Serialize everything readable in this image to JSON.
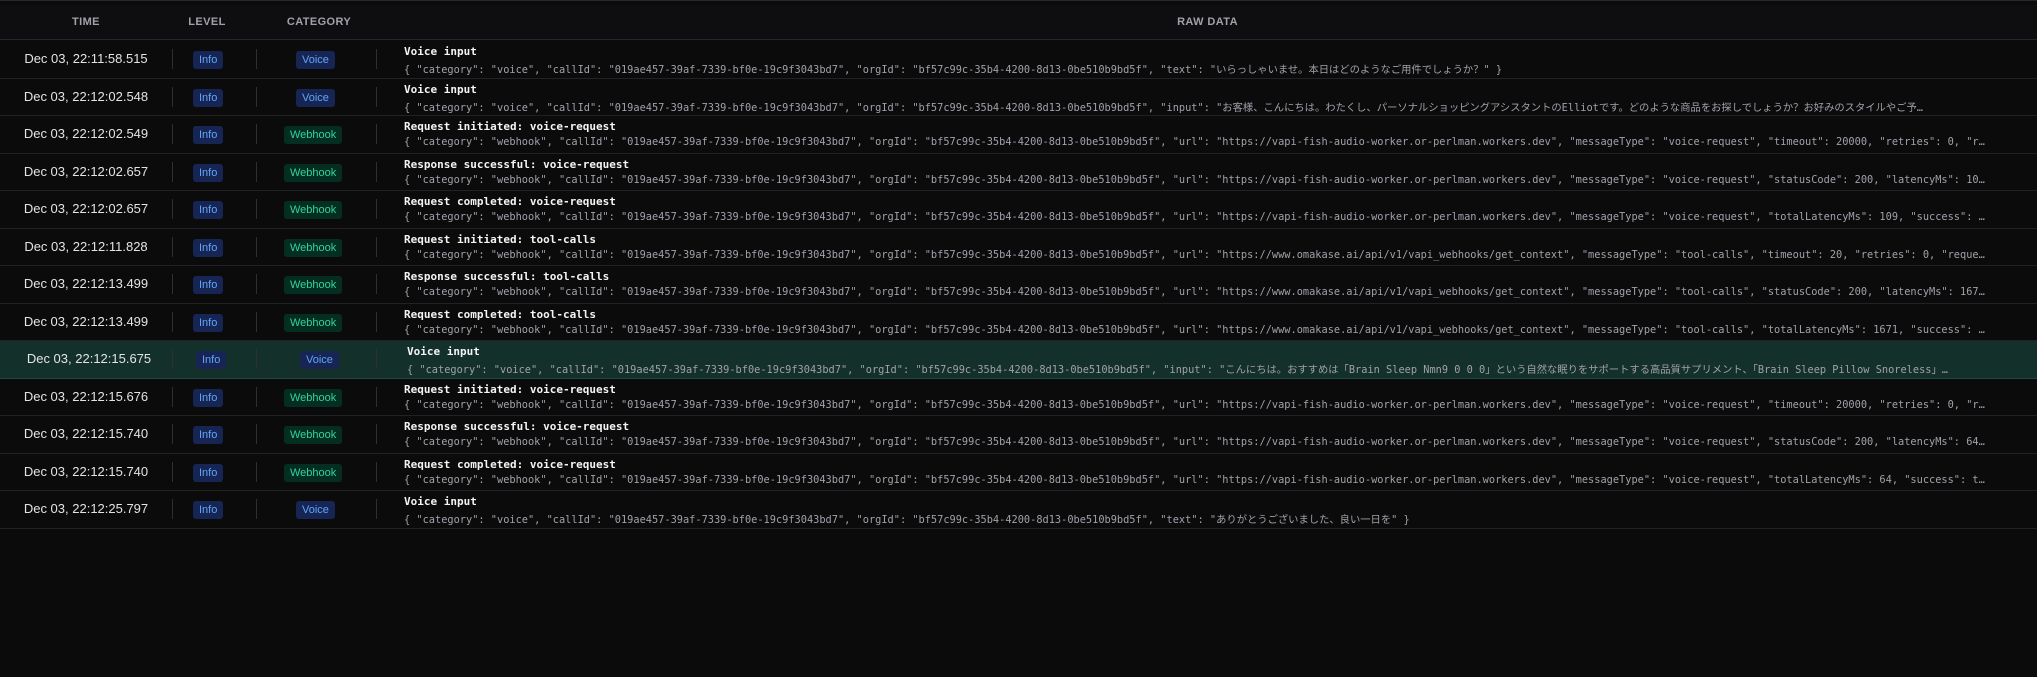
{
  "header": {
    "time": "TIME",
    "level": "LEVEL",
    "category": "CATEGORY",
    "raw": "RAW DATA"
  },
  "colors": {
    "info_badge": "#60a5fa",
    "voice_badge": "#60a5fa",
    "webhook_badge": "#34d399",
    "selected_row": "#13302b"
  },
  "rows": [
    {
      "time": "Dec 03, 22:11:58.515",
      "level": "Info",
      "category": "Voice",
      "message": "Voice input",
      "raw": "{ \"category\": \"voice\", \"callId\": \"019ae457-39af-7339-bf0e-19c9f3043bd7\", \"orgId\": \"bf57c99c-35b4-4200-8d13-0be510b9bd5f\", \"text\": \"いらっしゃいませ。本日はどのようなご用件でしょうか？\" }"
    },
    {
      "time": "Dec 03, 22:12:02.548",
      "level": "Info",
      "category": "Voice",
      "message": "Voice input",
      "raw": "{ \"category\": \"voice\", \"callId\": \"019ae457-39af-7339-bf0e-19c9f3043bd7\", \"orgId\": \"bf57c99c-35b4-4200-8d13-0be510b9bd5f\", \"input\": \"お客様、こんにちは。わたくし、パーソナルショッピングアシスタントのElliotです。どのような商品をお探しでしょうか？お好みのスタイルやご予…"
    },
    {
      "time": "Dec 03, 22:12:02.549",
      "level": "Info",
      "category": "Webhook",
      "message": "Request initiated: voice-request",
      "raw": "{ \"category\": \"webhook\", \"callId\": \"019ae457-39af-7339-bf0e-19c9f3043bd7\", \"orgId\": \"bf57c99c-35b4-4200-8d13-0be510b9bd5f\", \"url\": \"https://vapi-fish-audio-worker.or-perlman.workers.dev\", \"messageType\": \"voice-request\", \"timeout\": 20000, \"retries\": 0, \"re…"
    },
    {
      "time": "Dec 03, 22:12:02.657",
      "level": "Info",
      "category": "Webhook",
      "message": "Response successful: voice-request",
      "raw": "{ \"category\": \"webhook\", \"callId\": \"019ae457-39af-7339-bf0e-19c9f3043bd7\", \"orgId\": \"bf57c99c-35b4-4200-8d13-0be510b9bd5f\", \"url\": \"https://vapi-fish-audio-worker.or-perlman.workers.dev\", \"messageType\": \"voice-request\", \"statusCode\": 200, \"latencyMs\": 109…"
    },
    {
      "time": "Dec 03, 22:12:02.657",
      "level": "Info",
      "category": "Webhook",
      "message": "Request completed: voice-request",
      "raw": "{ \"category\": \"webhook\", \"callId\": \"019ae457-39af-7339-bf0e-19c9f3043bd7\", \"orgId\": \"bf57c99c-35b4-4200-8d13-0be510b9bd5f\", \"url\": \"https://vapi-fish-audio-worker.or-perlman.workers.dev\", \"messageType\": \"voice-request\", \"totalLatencyMs\": 109, \"success\": t…"
    },
    {
      "time": "Dec 03, 22:12:11.828",
      "level": "Info",
      "category": "Webhook",
      "message": "Request initiated: tool-calls",
      "raw": "{ \"category\": \"webhook\", \"callId\": \"019ae457-39af-7339-bf0e-19c9f3043bd7\", \"orgId\": \"bf57c99c-35b4-4200-8d13-0be510b9bd5f\", \"url\": \"https://www.omakase.ai/api/v1/vapi_webhooks/get_context\", \"messageType\": \"tool-calls\", \"timeout\": 20, \"retries\": 0, \"reques…"
    },
    {
      "time": "Dec 03, 22:12:13.499",
      "level": "Info",
      "category": "Webhook",
      "message": "Response successful: tool-calls",
      "raw": "{ \"category\": \"webhook\", \"callId\": \"019ae457-39af-7339-bf0e-19c9f3043bd7\", \"orgId\": \"bf57c99c-35b4-4200-8d13-0be510b9bd5f\", \"url\": \"https://www.omakase.ai/api/v1/vapi_webhooks/get_context\", \"messageType\": \"tool-calls\", \"statusCode\": 200, \"latencyMs\": 1671…"
    },
    {
      "time": "Dec 03, 22:12:13.499",
      "level": "Info",
      "category": "Webhook",
      "message": "Request completed: tool-calls",
      "raw": "{ \"category\": \"webhook\", \"callId\": \"019ae457-39af-7339-bf0e-19c9f3043bd7\", \"orgId\": \"bf57c99c-35b4-4200-8d13-0be510b9bd5f\", \"url\": \"https://www.omakase.ai/api/v1/vapi_webhooks/get_context\", \"messageType\": \"tool-calls\", \"totalLatencyMs\": 1671, \"success\": t…"
    },
    {
      "time": "Dec 03, 22:12:15.675",
      "level": "Info",
      "category": "Voice",
      "message": "Voice input",
      "raw": "{ \"category\": \"voice\", \"callId\": \"019ae457-39af-7339-bf0e-19c9f3043bd7\", \"orgId\": \"bf57c99c-35b4-4200-8d13-0be510b9bd5f\", \"input\": \"こんにちは。おすすめは「Brain Sleep Nmn9 0 0 0」という自然な眠りをサポートする高品質サプリメント、「Brain Sleep Pillow Snoreless」…",
      "selected": true
    },
    {
      "time": "Dec 03, 22:12:15.676",
      "level": "Info",
      "category": "Webhook",
      "message": "Request initiated: voice-request",
      "raw": "{ \"category\": \"webhook\", \"callId\": \"019ae457-39af-7339-bf0e-19c9f3043bd7\", \"orgId\": \"bf57c99c-35b4-4200-8d13-0be510b9bd5f\", \"url\": \"https://vapi-fish-audio-worker.or-perlman.workers.dev\", \"messageType\": \"voice-request\", \"timeout\": 20000, \"retries\": 0, \"re…"
    },
    {
      "time": "Dec 03, 22:12:15.740",
      "level": "Info",
      "category": "Webhook",
      "message": "Response successful: voice-request",
      "raw": "{ \"category\": \"webhook\", \"callId\": \"019ae457-39af-7339-bf0e-19c9f3043bd7\", \"orgId\": \"bf57c99c-35b4-4200-8d13-0be510b9bd5f\", \"url\": \"https://vapi-fish-audio-worker.or-perlman.workers.dev\", \"messageType\": \"voice-request\", \"statusCode\": 200, \"latencyMs\": 64 }"
    },
    {
      "time": "Dec 03, 22:12:15.740",
      "level": "Info",
      "category": "Webhook",
      "message": "Request completed: voice-request",
      "raw": "{ \"category\": \"webhook\", \"callId\": \"019ae457-39af-7339-bf0e-19c9f3043bd7\", \"orgId\": \"bf57c99c-35b4-4200-8d13-0be510b9bd5f\", \"url\": \"https://vapi-fish-audio-worker.or-perlman.workers.dev\", \"messageType\": \"voice-request\", \"totalLatencyMs\": 64, \"success\": tr…"
    },
    {
      "time": "Dec 03, 22:12:25.797",
      "level": "Info",
      "category": "Voice",
      "message": "Voice input",
      "raw": "{ \"category\": \"voice\", \"callId\": \"019ae457-39af-7339-bf0e-19c9f3043bd7\", \"orgId\": \"bf57c99c-35b4-4200-8d13-0be510b9bd5f\", \"text\": \"ありがとうございました、良い一日を\" }"
    }
  ]
}
